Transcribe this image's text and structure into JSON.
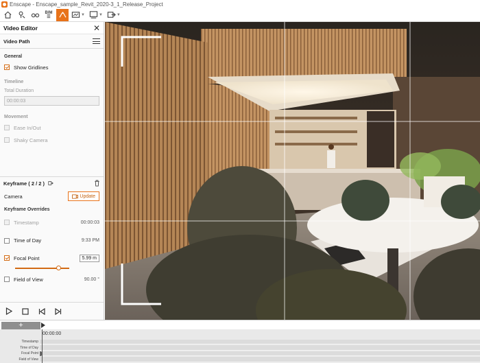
{
  "app": {
    "title": "Enscape - Enscape_sample_Revit_2020-3_1_Release_Project"
  },
  "toolbar": {
    "items": [
      {
        "icon": "home-icon"
      },
      {
        "icon": "location-pin-icon"
      },
      {
        "icon": "binoculars-icon"
      },
      {
        "icon": "bim-icon",
        "label": "BIM"
      },
      {
        "icon": "video-editor-icon",
        "active": true
      },
      {
        "icon": "screenshot-icon"
      },
      {
        "icon": "batch-render-icon"
      },
      {
        "icon": "export-icon"
      }
    ],
    "accent": "#e8731a"
  },
  "sidebar": {
    "panel_title": "Video Editor",
    "path_title": "Video Path",
    "general": {
      "label": "General",
      "show_gridlines_label": "Show Gridlines",
      "show_gridlines": true
    },
    "timeline": {
      "label": "Timeline",
      "total_duration_label": "Total Duration",
      "total_duration_value": "00:00:03"
    },
    "movement": {
      "label": "Movement",
      "ease_label": "Ease In/Out",
      "shaky_label": "Shaky Camera"
    },
    "keyframe": {
      "title": "Keyframe ( 2 / 2 )",
      "camera_label": "Camera",
      "update_label": "Update",
      "overrides_label": "Keyframe Overrides",
      "timestamp_label": "Timestamp",
      "timestamp_value": "00:00:03",
      "time_of_day_label": "Time of Day",
      "time_of_day_value": "9:33 PM",
      "focal_point_label": "Focal Point",
      "focal_point_value": "5.99  m",
      "focal_point_checked": true,
      "focal_slider_fraction": 0.8,
      "fov_label": "Field of View",
      "fov_value": "90.00 °"
    }
  },
  "timeline": {
    "add_label": "+",
    "current_time": "00:00:00",
    "tracks": [
      "Timestamp",
      "Time of Day",
      "Focal Point",
      "Field of View"
    ]
  }
}
